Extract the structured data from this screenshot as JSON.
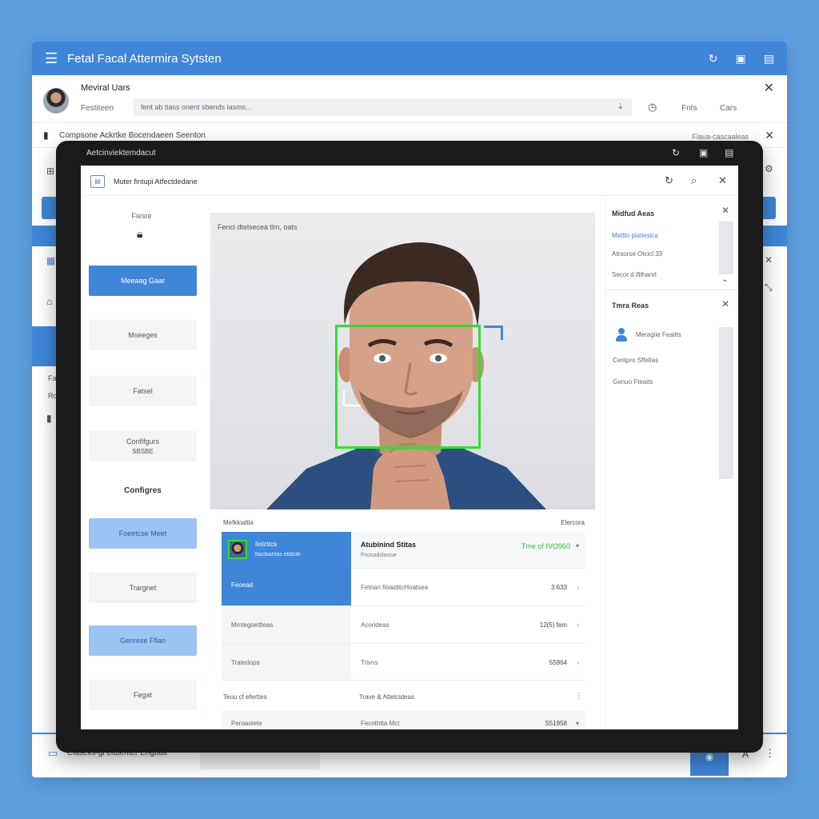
{
  "background_window": {
    "title": "Fetal Facal Attermira Sytsten",
    "user_name": "Meviral Uars",
    "field_label": "Festiteen",
    "search_text": "fent ab tiass onent sbends iasms...",
    "btn_1": "Fnts",
    "btn_2": "Cars",
    "section_label": "Compsone Ackrtke Bocendaeen Seenton",
    "section_right_label": "Fiaua-cascaaleas",
    "left_labels": [
      "Fa",
      "Ro"
    ],
    "footer_label": "Claseks-gi eltdenter Engbait",
    "footer_btn_letter": "A"
  },
  "tablet": {
    "title": "Aetcinviektemdacut"
  },
  "screen": {
    "header_title": "Muter fintupi Atfectdedane",
    "nav": {
      "heading": "Fiesre",
      "buttons": [
        {
          "label": "Meeaag Gaar",
          "style": "primary"
        },
        {
          "label": "Mseeges",
          "style": "normal"
        },
        {
          "label": "Fatsel",
          "style": "normal"
        },
        {
          "label": "Confifgurs",
          "sub": "SBSBE",
          "style": "normal"
        }
      ],
      "section_label": "Configres",
      "buttons2": [
        {
          "label": "Foeetcse Meet",
          "style": "light"
        },
        {
          "label": "Trargnet",
          "style": "normal"
        },
        {
          "label": "Genrese Ffian",
          "style": "light"
        },
        {
          "label": "Fegat",
          "style": "normal"
        }
      ]
    },
    "camera": {
      "label": "Fenci dtelsecea tlm, oats"
    },
    "table": {
      "head_left": "Mefkkialtla",
      "head_right": "Elercora",
      "selected": {
        "name": "Iiotcttcs",
        "sub": "ttacbiaritas ettdcte",
        "status": "Feoead"
      },
      "status": {
        "title": "Atubinind Stitas",
        "sub": "Fnosadvlasise",
        "time": "Tme of IVO960"
      },
      "rows": [
        {
          "left": "",
          "right_label": "Fetnan fioaiditcHoatsea",
          "value": "3.633"
        },
        {
          "left": "Mmtegoettleas",
          "right_label": "Acorideas",
          "value": "12(5) fem"
        },
        {
          "left": "Tratedops",
          "right_label": "Trivns",
          "value": "55964"
        }
      ],
      "section2": {
        "left": "Teuu cf eferttes",
        "right": "Trave & Attetcideas"
      },
      "last_row": {
        "left": "Peroaoiete",
        "right_label": "Fecnthtta Mct",
        "value": "S51958"
      }
    },
    "right_panel": {
      "panel1": {
        "title": "Midfud Aeas",
        "link": "Mattto piatiesica",
        "items": [
          "Atrsorse Otcicl.33",
          "Secor d ifithanrt"
        ]
      },
      "panel2": {
        "title": "Tmra Reas",
        "items": [
          "Meragiie Feaitts",
          "Centpro Sffeltas",
          "Genuo Fteaits"
        ]
      }
    }
  },
  "colors": {
    "accent": "#3f86d8",
    "accent_light": "#9cc3f1",
    "detection": "#2fe02f",
    "background": "#5f9fe0"
  }
}
